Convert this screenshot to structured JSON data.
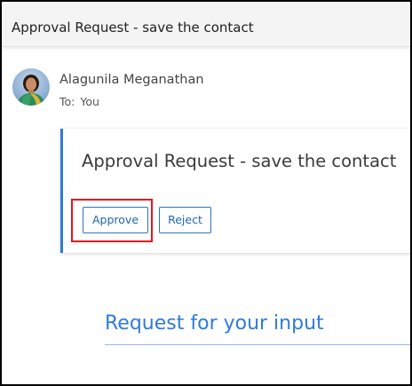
{
  "header": {
    "title": "Approval Request - save the contact"
  },
  "message": {
    "sender_name": "Alagunila Meganathan",
    "to_label": "To:",
    "to_value": "You",
    "avatar_icon": "user-avatar-photo"
  },
  "card": {
    "title": "Approval Request - save the contact",
    "accent_color": "#2f7bd8",
    "approve_label": "Approve",
    "reject_label": "Reject"
  },
  "annotation": {
    "highlight_color": "#e8141c",
    "highlighted_target": "Approve"
  },
  "body_section": {
    "heading": "Request for your input"
  }
}
